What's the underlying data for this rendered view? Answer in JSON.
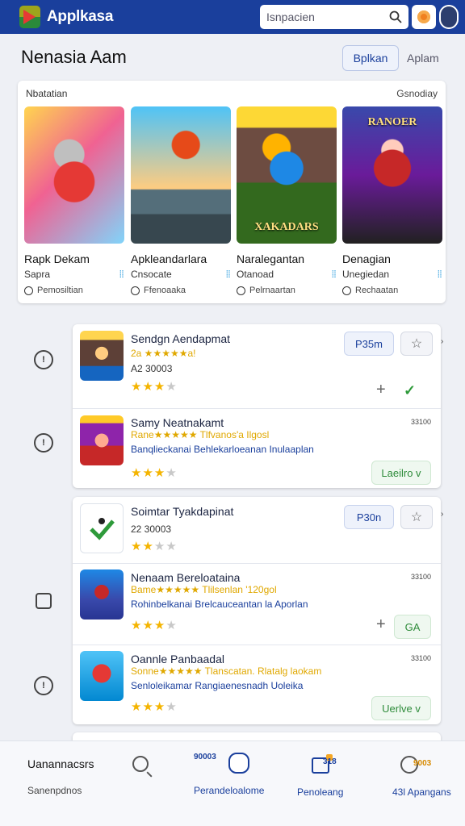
{
  "app": {
    "title": "Applkasa"
  },
  "search": {
    "placeholder": "Isnpacien"
  },
  "section": {
    "title": "Nenasia Aam",
    "button": "Bplkan",
    "link": "Aplam"
  },
  "featured": {
    "label": "Nbatatian",
    "link": "Gsnodiay",
    "games": [
      {
        "name": "Rapk Dekam",
        "sub": "Sapra",
        "meta": "Pemosiltian",
        "art_title": ""
      },
      {
        "name": "Apkleandarlara",
        "sub": "Cnsocate",
        "meta": "Ffenoaaka",
        "art_title": ""
      },
      {
        "name": "Naralegantan",
        "sub": "Otanoad",
        "meta": "Pelrnaartan",
        "art_title": "XAKADARS"
      },
      {
        "name": "Denagian",
        "sub": "Unegiedan",
        "meta": "Rechaatan",
        "art_title": "RANOER"
      }
    ]
  },
  "list_card_1": [
    {
      "title": "Sendgn Aendapmat",
      "rating_text": "2a ★★★★★a!",
      "sub": "A2 30003",
      "stars": 3,
      "button": "P35m",
      "has_star_btn": true
    },
    {
      "title": "Samy Neatnakamt",
      "promo": "Rane★★★★★ Tlfvanos'a Ilgosl",
      "desc": "Banqlieckanai Behlekarloeanan Inulaaplan",
      "tiny": "33100",
      "stars": 3,
      "button": "Laeilro v"
    }
  ],
  "list_card_2": [
    {
      "title": "Soimtar Tyakdapinat",
      "sub": "22 30003",
      "stars": 2,
      "button": "P30n",
      "has_star_btn": true
    },
    {
      "title": "Nenaam Bereloataina",
      "promo": "Bame★★★★★ Tlilsenlan '120gol",
      "desc": "Rohinbelkanai Brelcauceantan la Aporlan",
      "tiny": "33100",
      "stars": 3,
      "button": "GA"
    },
    {
      "title": "Oannle Panbaadal",
      "promo": "Sonne★★★★★ Tlanscatan. Rlatalg laokam",
      "desc": "Senloleikamar Rangiaenesnadh Uoleika",
      "tiny": "33100",
      "stars": 3,
      "button": "Uerlve v"
    }
  ],
  "bottom_nav": {
    "title": "Uanannacsrs",
    "subtitle": "Sanenpdnos",
    "items": [
      {
        "label": "Perandeloalome",
        "badge": "90003"
      },
      {
        "label": "Penoleang",
        "badge": "318"
      },
      {
        "label": "43l Apangans",
        "badge": "9003"
      }
    ]
  }
}
